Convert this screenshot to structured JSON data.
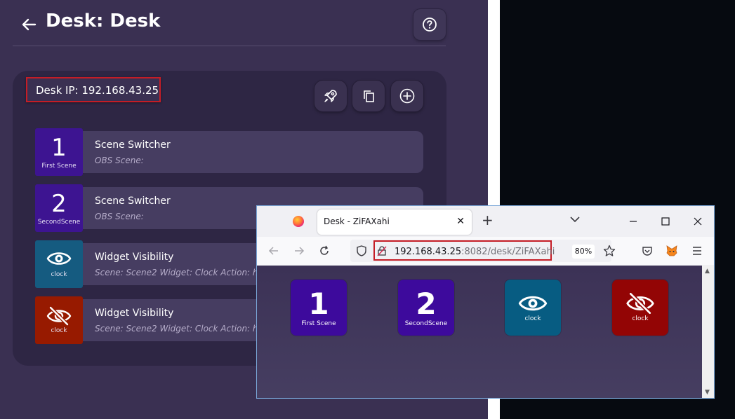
{
  "app": {
    "title": "Desk: Desk",
    "desk_ip": "Desk IP: 192.168.43.25",
    "actions": [
      {
        "tile_number": "1",
        "tile_caption": "First Scene",
        "tile_color": "#3d1491",
        "title": "Scene Switcher",
        "subtitle": "OBS Scene:"
      },
      {
        "tile_number": "2",
        "tile_caption": "SecondScene",
        "tile_color": "#3d1491",
        "title": "Scene Switcher",
        "subtitle": "OBS Scene:"
      },
      {
        "tile_icon": "eye-icon",
        "tile_caption": "clock",
        "tile_color": "#155b80",
        "title": "Widget Visibility",
        "subtitle": "Scene: Scene2   Widget: Clock    Action: h"
      },
      {
        "tile_icon": "eye-slash-icon",
        "tile_caption": "clock",
        "tile_color": "#971a00",
        "title": "Widget Visibility",
        "subtitle": "Scene: Scene2   Widget: Clock    Action: h"
      }
    ]
  },
  "browser": {
    "tab_title": "Desk - ZiFAXahi",
    "url_host": "192.168.43.25",
    "url_rest": ":8082/desk/ZiFAXahi",
    "zoom": "80%",
    "deck_buttons": [
      {
        "number": "1",
        "caption": "First Scene",
        "color": "#3d0a9c"
      },
      {
        "number": "2",
        "caption": "SecondScene",
        "color": "#3d0a9c"
      },
      {
        "icon": "eye-icon",
        "caption": "clock",
        "color": "#075c82"
      },
      {
        "icon": "eye-slash-icon",
        "caption": "clock",
        "color": "#930505"
      }
    ]
  },
  "colors": {
    "app_bg": "#3a3052",
    "card_bg": "#2e2644",
    "highlight_border": "#c51d26"
  }
}
